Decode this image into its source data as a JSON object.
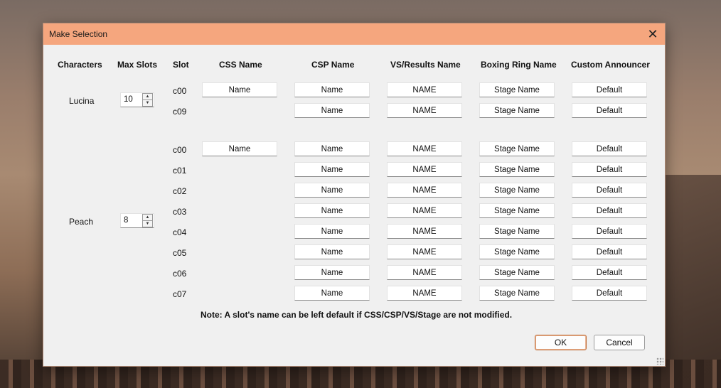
{
  "dialog": {
    "title": "Make Selection",
    "close_icon": "close-icon",
    "accent_color": "#f5a67e"
  },
  "headers": {
    "characters": "Characters",
    "max_slots": "Max Slots",
    "slot": "Slot",
    "css_name": "CSS Name",
    "csp_name": "CSP Name",
    "vs_results_name": "VS/Results Name",
    "boxing_ring_name": "Boxing Ring Name",
    "custom_announcer": "Custom Announcer"
  },
  "characters": [
    {
      "name": "Lucina",
      "max_slots": "10",
      "css_name": "Name",
      "slots": [
        {
          "slot": "c00",
          "csp": "Name",
          "vs": "NAME",
          "ring": "Stage Name",
          "announcer": "Default"
        },
        {
          "slot": "c09",
          "csp": "Name",
          "vs": "NAME",
          "ring": "Stage Name",
          "announcer": "Default"
        }
      ]
    },
    {
      "name": "Peach",
      "max_slots": "8",
      "css_name": "Name",
      "slots": [
        {
          "slot": "c00",
          "csp": "Name",
          "vs": "NAME",
          "ring": "Stage Name",
          "announcer": "Default"
        },
        {
          "slot": "c01",
          "csp": "Name",
          "vs": "NAME",
          "ring": "Stage Name",
          "announcer": "Default"
        },
        {
          "slot": "c02",
          "csp": "Name",
          "vs": "NAME",
          "ring": "Stage Name",
          "announcer": "Default"
        },
        {
          "slot": "c03",
          "csp": "Name",
          "vs": "NAME",
          "ring": "Stage Name",
          "announcer": "Default"
        },
        {
          "slot": "c04",
          "csp": "Name",
          "vs": "NAME",
          "ring": "Stage Name",
          "announcer": "Default"
        },
        {
          "slot": "c05",
          "csp": "Name",
          "vs": "NAME",
          "ring": "Stage Name",
          "announcer": "Default"
        },
        {
          "slot": "c06",
          "csp": "Name",
          "vs": "NAME",
          "ring": "Stage Name",
          "announcer": "Default"
        },
        {
          "slot": "c07",
          "csp": "Name",
          "vs": "NAME",
          "ring": "Stage Name",
          "announcer": "Default"
        }
      ]
    }
  ],
  "note": "Note: A slot's name can be left default if CSS/CSP/VS/Stage are not modified.",
  "buttons": {
    "ok": "OK",
    "cancel": "Cancel"
  }
}
